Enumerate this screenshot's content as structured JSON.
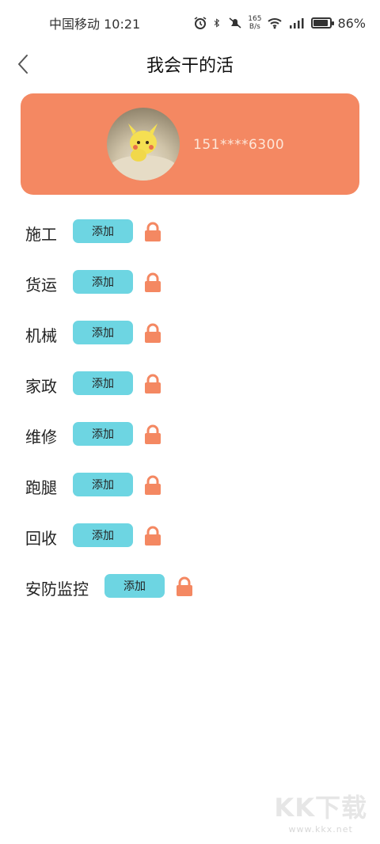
{
  "status_bar": {
    "carrier_time": "中国移动 10:21",
    "speed_value": "165",
    "speed_unit": "B/s",
    "battery": "86%",
    "battery_level": 0.86
  },
  "header": {
    "title": "我会干的活",
    "back_icon": "chevron-left-icon"
  },
  "profile": {
    "phone": "151****6300",
    "card_color": "#f48862"
  },
  "skills": [
    {
      "label": "施工",
      "button": "添加"
    },
    {
      "label": "货运",
      "button": "添加"
    },
    {
      "label": "机械",
      "button": "添加"
    },
    {
      "label": "家政",
      "button": "添加"
    },
    {
      "label": "维修",
      "button": "添加"
    },
    {
      "label": "跑腿",
      "button": "添加"
    },
    {
      "label": "回收",
      "button": "添加"
    },
    {
      "label": "安防监控",
      "button": "添加"
    }
  ],
  "colors": {
    "button": "#6dd5e2",
    "lock": "#f48862"
  },
  "watermark": {
    "logo": "KK下载",
    "url": "www.kkx.net"
  }
}
